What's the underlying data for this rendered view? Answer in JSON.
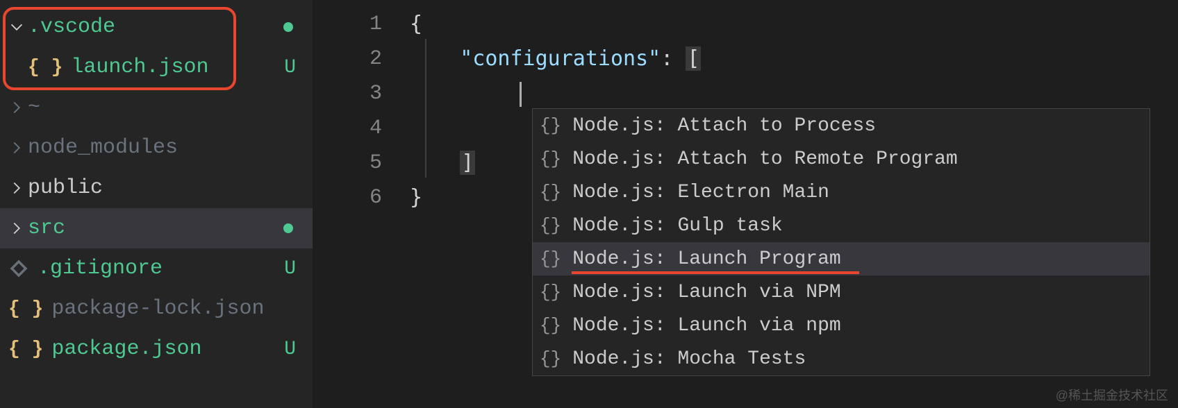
{
  "sidebar": {
    "items": [
      {
        "name": ".vscode",
        "type": "folder-open",
        "color": "green",
        "status": "dot"
      },
      {
        "name": "launch.json",
        "type": "json-file",
        "color": "green",
        "status": "U",
        "indent": true
      },
      {
        "name": "~",
        "type": "folder",
        "color": "gray",
        "status": ""
      },
      {
        "name": "node_modules",
        "type": "folder",
        "color": "gray",
        "status": ""
      },
      {
        "name": "public",
        "type": "folder",
        "color": "white",
        "status": ""
      },
      {
        "name": "src",
        "type": "folder",
        "color": "green",
        "status": "dot",
        "selected": true
      },
      {
        "name": ".gitignore",
        "type": "git-file",
        "color": "green",
        "status": "U"
      },
      {
        "name": "package-lock.json",
        "type": "json-file",
        "color": "gray",
        "status": ""
      },
      {
        "name": "package.json",
        "type": "json-file",
        "color": "green",
        "status": "U"
      }
    ]
  },
  "editor": {
    "lines": [
      {
        "num": "1",
        "content": "{"
      },
      {
        "num": "2",
        "content": "\"configurations\": ["
      },
      {
        "num": "3",
        "content": ""
      },
      {
        "num": "4",
        "content": ""
      },
      {
        "num": "5",
        "content": "]"
      },
      {
        "num": "6",
        "content": "}"
      }
    ],
    "key": "\"configurations\"",
    "colon": ": ",
    "open_bracket": "[",
    "close_bracket": "]",
    "open_brace": "{",
    "close_brace": "}"
  },
  "suggestions": [
    {
      "label": "Node.js: Attach to Process"
    },
    {
      "label": "Node.js: Attach to Remote Program"
    },
    {
      "label": "Node.js: Electron Main"
    },
    {
      "label": "Node.js: Gulp task"
    },
    {
      "label": "Node.js: Launch Program",
      "highlighted": true,
      "selected": true
    },
    {
      "label": "Node.js: Launch via NPM"
    },
    {
      "label": "Node.js: Launch via npm"
    },
    {
      "label": "Node.js: Mocha Tests"
    }
  ],
  "watermark": "@稀土掘金技术社区"
}
